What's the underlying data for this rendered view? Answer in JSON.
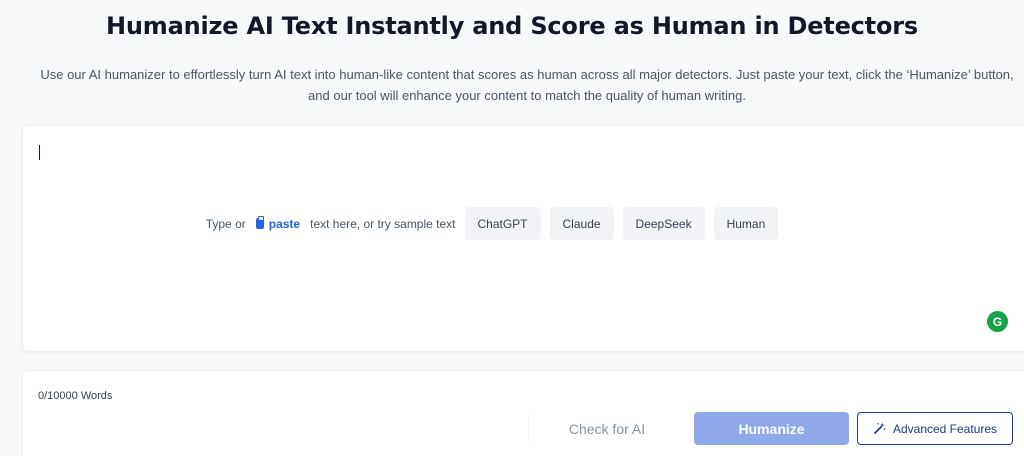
{
  "header": {
    "title": "Humanize AI Text Instantly and Score as Human in Detectors",
    "subtitle": "Use our AI humanizer to effortlessly turn AI text into human-like content that scores as human across all major detectors. Just paste your text, click the ‘Humanize’ button, and our tool will enhance your content to match the quality of human writing."
  },
  "editor": {
    "prompt_prefix": "Type or",
    "paste_label": "paste",
    "prompt_suffix": "text here, or try sample text",
    "samples": [
      "ChatGPT",
      "Claude",
      "DeepSeek",
      "Human"
    ],
    "grammarly_letter": "G"
  },
  "footer": {
    "word_count": "0/10000 Words",
    "check_label": "Check for AI",
    "humanize_label": "Humanize",
    "advanced_label": "Advanced Features"
  },
  "colors": {
    "accent": "#2563eb",
    "humanize_button": "#8ea8ea",
    "advanced_border": "#1e3a8a",
    "grammarly": "#15a34a"
  },
  "icons": [
    "clipboard-icon",
    "grammarly-icon",
    "magic-wand-icon"
  ]
}
